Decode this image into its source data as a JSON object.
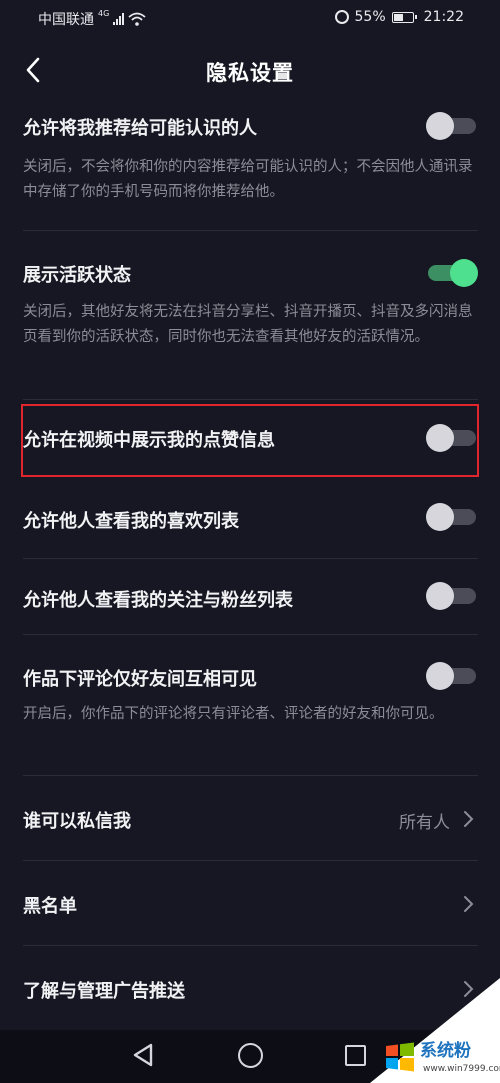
{
  "status_bar": {
    "carrier": "中国联通",
    "network": "4G",
    "battery_percent": "55%",
    "battery_level": 0.55,
    "time": "21:22"
  },
  "header": {
    "title": "隐私设置",
    "back_icon": "chevron-left-icon"
  },
  "settings": [
    {
      "title": "允许将我推荐给可能认识的人",
      "description": "关闭后，不会将你和你的内容推荐给可能认识的人；不会因他人通讯录中存储了你的手机号码而将你推荐给他。",
      "toggle": false
    },
    {
      "title": "展示活跃状态",
      "description": "关闭后，其他好友将无法在抖音分享栏、抖音开播页、抖音及多闪消息页看到你的活跃状态，同时你也无法查看其他好友的活跃情况。",
      "toggle": true
    },
    {
      "title": "允许在视频中展示我的点赞信息",
      "toggle": false,
      "highlighted": true
    },
    {
      "title": "允许他人查看我的喜欢列表",
      "toggle": false
    },
    {
      "title": "允许他人查看我的关注与粉丝列表",
      "toggle": false
    },
    {
      "title": "作品下评论仅好友间互相可见",
      "description": "开启后，你作品下的评论将只有评论者、评论者的好友和你可见。",
      "toggle": false
    }
  ],
  "nav_rows": [
    {
      "title": "谁可以私信我",
      "value": "所有人"
    },
    {
      "title": "黑名单"
    },
    {
      "title": "了解与管理广告推送"
    }
  ],
  "colors": {
    "background": "#161722",
    "toggle_on": "#4ee08f",
    "highlight_border": "#e0262c"
  },
  "watermark": {
    "text": "系统粉",
    "url": "www.win7999.com"
  },
  "system_nav": {
    "back_icon": "triangle-back-icon",
    "home_icon": "circle-home-icon",
    "recent_icon": "square-recent-icon"
  }
}
